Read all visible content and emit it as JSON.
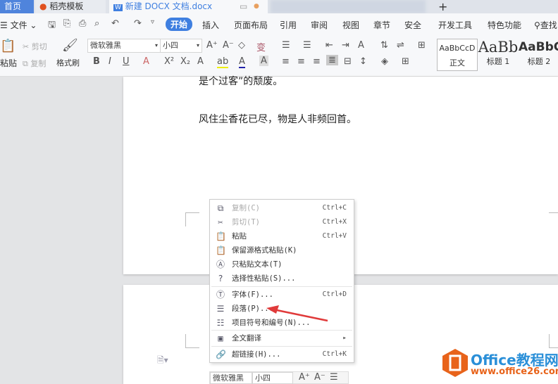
{
  "tabs": {
    "home": "首页",
    "template": "稻壳模板",
    "doc": "新建 DOCX 文档.docx",
    "new_tab": "+"
  },
  "menu": {
    "file": "文件",
    "items": [
      "开始",
      "插入",
      "页面布局",
      "引用",
      "审阅",
      "视图",
      "章节",
      "安全",
      "开发工具",
      "特色功能"
    ],
    "search": "查找"
  },
  "ribbon": {
    "paste": "粘贴",
    "cut": "剪切",
    "copy": "复制",
    "format_painter": "格式刷",
    "font": "微软雅黑",
    "size": "小四",
    "styles": [
      {
        "preview": "AaBbCcD",
        "label": "正文"
      },
      {
        "preview": "AaBb",
        "label": "标题 1"
      },
      {
        "preview": "AaBbC",
        "label": "标题 2"
      }
    ]
  },
  "document": {
    "line1": "是个过客”的颓废。",
    "line2": "风住尘香花已尽，物是人非频回首。"
  },
  "context_menu": [
    {
      "label": "复制(C)",
      "shortcut": "Ctrl+C",
      "icon": "copy-icon",
      "disabled": true
    },
    {
      "label": "剪切(T)",
      "shortcut": "Ctrl+X",
      "icon": "scissors-icon",
      "disabled": true
    },
    {
      "label": "粘贴",
      "shortcut": "Ctrl+V",
      "icon": "paste-icon"
    },
    {
      "label": "保留源格式粘贴(K)",
      "shortcut": "",
      "icon": "paste-keep-format-icon"
    },
    {
      "label": "只粘贴文本(T)",
      "shortcut": "",
      "icon": "paste-text-icon"
    },
    {
      "label": "选择性粘贴(S)...",
      "shortcut": "",
      "icon": "paste-special-icon"
    },
    {
      "label": "字体(F)...",
      "shortcut": "Ctrl+D",
      "icon": "font-icon"
    },
    {
      "label": "段落(P)...",
      "shortcut": "",
      "icon": "paragraph-icon"
    },
    {
      "label": "项目符号和编号(N)...",
      "shortcut": "",
      "icon": "list-icon"
    },
    {
      "label": "全文翻译",
      "shortcut": "",
      "icon": "translate-icon"
    },
    {
      "label": "超链接(H)...",
      "shortcut": "Ctrl+K",
      "icon": "link-icon"
    }
  ],
  "mini_toolbar": {
    "font": "微软雅黑",
    "size": "小四"
  },
  "watermark": {
    "title": "Office教程网",
    "url": "www.office26.com"
  },
  "colors": {
    "accent": "#3f7fe0",
    "arrow": "#e03a3a",
    "logo": "#e8631a"
  }
}
